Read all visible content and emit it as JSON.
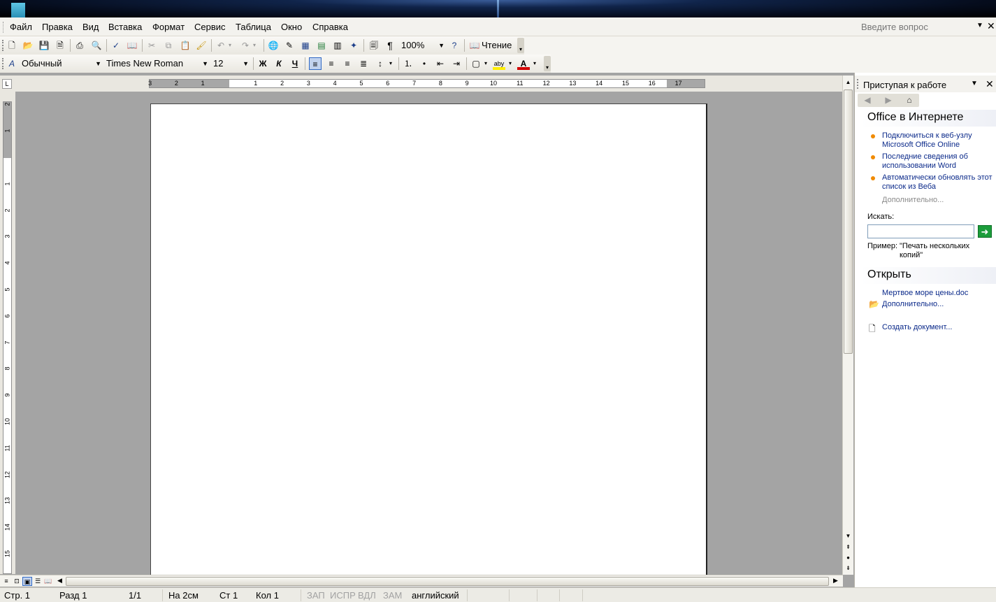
{
  "menu": [
    "Файл",
    "Правка",
    "Вид",
    "Вставка",
    "Формат",
    "Сервис",
    "Таблица",
    "Окно",
    "Справка"
  ],
  "help_box": {
    "placeholder": "Введите вопрос"
  },
  "toolbar_standard": {
    "zoom": "100%",
    "reading_label": "Чтение"
  },
  "toolbar_format": {
    "style": "Обычный",
    "font": "Times New Roman",
    "size": "12",
    "bold": "Ж",
    "italic": "К",
    "underline": "Ч",
    "highlight_text": "aby",
    "font_color_text": "A"
  },
  "colors": {
    "highlight": "#ffee00",
    "font_color": "#d40000",
    "bullet": "#f08a00",
    "link": "#0b2a8a"
  },
  "ruler": {
    "h_labels": [
      "3",
      "2",
      "1",
      "1",
      "2",
      "3",
      "4",
      "5",
      "6",
      "7",
      "8",
      "9",
      "10",
      "11",
      "12",
      "13",
      "14",
      "15",
      "16",
      "17"
    ],
    "v_labels": [
      "2",
      "1",
      "1",
      "2",
      "3",
      "4",
      "5",
      "6",
      "7",
      "8",
      "9",
      "10",
      "11",
      "12",
      "13",
      "14",
      "15"
    ]
  },
  "status": {
    "page": "Стр. 1",
    "section": "Разд 1",
    "pages": "1/1",
    "at": "На 2см",
    "line": "Ст 1",
    "col": "Кол 1",
    "rec": "ЗАП",
    "trk": "ИСПР",
    "ext": "ВДЛ",
    "ovr": "ЗАМ",
    "lang": "английский"
  },
  "taskpane": {
    "title": "Приступая к работе",
    "online_header": "Office в Интернете",
    "links": [
      "Подключиться к веб-узлу Microsoft Office Online",
      "Последние сведения об использовании Word",
      "Автоматически обновлять этот список из Веба"
    ],
    "more": "Дополнительно...",
    "search_label": "Искать:",
    "example_label": "Пример:",
    "example_text": "\"Печать нескольких копий\"",
    "open_header": "Открыть",
    "recent_file": "Мертвое море цены.doc",
    "open_more": "Дополнительно...",
    "create": "Создать документ..."
  }
}
